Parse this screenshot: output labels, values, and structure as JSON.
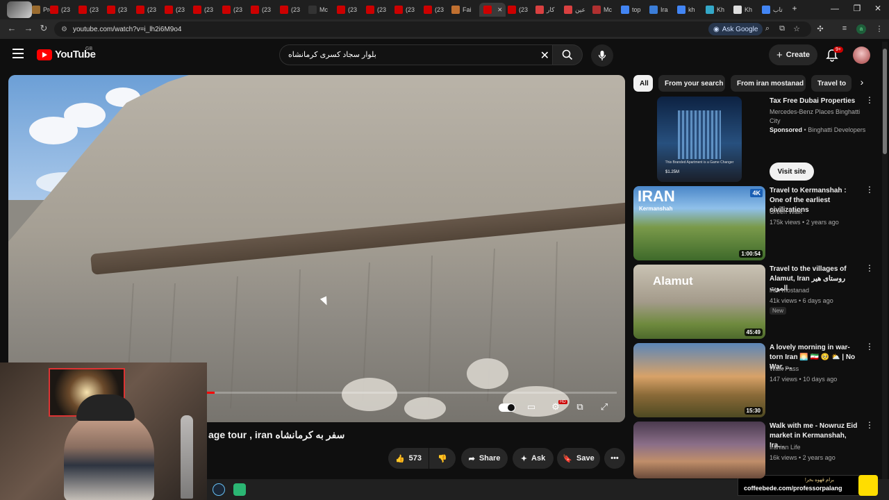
{
  "browser": {
    "tabs": [
      {
        "label": "Pro",
        "color": "#9a6b2e"
      },
      {
        "label": "(23",
        "color": "#cc0000"
      },
      {
        "label": "(23",
        "color": "#cc0000"
      },
      {
        "label": "(23",
        "color": "#cc0000"
      },
      {
        "label": "(23",
        "color": "#cc0000"
      },
      {
        "label": "(23",
        "color": "#cc0000"
      },
      {
        "label": "(23",
        "color": "#cc0000"
      },
      {
        "label": "(23",
        "color": "#cc0000"
      },
      {
        "label": "(23",
        "color": "#cc0000"
      },
      {
        "label": "(23",
        "color": "#cc0000"
      },
      {
        "label": "Mc",
        "color": "#333333"
      },
      {
        "label": "(23",
        "color": "#cc0000"
      },
      {
        "label": "(23",
        "color": "#cc0000"
      },
      {
        "label": "(23",
        "color": "#cc0000"
      },
      {
        "label": "(23",
        "color": "#cc0000"
      },
      {
        "label": "Fai",
        "color": "#c07030"
      },
      {
        "label": "",
        "color": "#cc0000"
      },
      {
        "label": "(23",
        "color": "#cc0000"
      },
      {
        "label": "کار",
        "color": "#d94040"
      },
      {
        "label": "عین",
        "color": "#d94040"
      },
      {
        "label": "Mc",
        "color": "#b03030"
      },
      {
        "label": "top",
        "color": "#4285f4"
      },
      {
        "label": "Ira",
        "color": "#3b7dd8"
      },
      {
        "label": "kh",
        "color": "#4285f4"
      },
      {
        "label": "Kh",
        "color": "#34a8c8"
      },
      {
        "label": "Kh",
        "color": "#dddddd"
      },
      {
        "label": "تاب",
        "color": "#4285f4"
      }
    ],
    "new_tab": "+",
    "window_controls": {
      "minimize": "—",
      "restore": "❐",
      "close": "✕"
    },
    "url": "youtube.com/watch?v=i_lh2i6M9o4",
    "ask_google": "Ask Google",
    "profile_initial": "a"
  },
  "youtube": {
    "logo": "YouTube",
    "region": "GB",
    "search_query": "بلوار سجاد کسری کرمانشاه",
    "create_label": "Create",
    "notification_count": "9+"
  },
  "video": {
    "title": "age tour , iran سفر به کرمانشاه",
    "progress": 0.33,
    "likes": "573",
    "share": "Share",
    "ask": "Ask",
    "save": "Save",
    "hd_badge": "HD"
  },
  "chips": [
    {
      "label": "All",
      "active": true
    },
    {
      "label": "From your search",
      "active": false
    },
    {
      "label": "From iran mostanad",
      "active": false
    },
    {
      "label": "Travel to",
      "active": false
    }
  ],
  "sidebar": {
    "ad": {
      "title": "Tax Free Dubai Properties",
      "advertiser": "Mercedes-Benz Places Binghatti City",
      "sponsored": "Sponsored",
      "sponsor_name": "Binghatti Developers",
      "visit": "Visit site",
      "thumb_caption": "This Branded Apartment is a Game Changer",
      "thumb_price": "$1.25M"
    },
    "items": [
      {
        "title": "Travel to Kermanshah : One of the earliest civilizations",
        "channel": "Green Walk",
        "meta": "175k views • 2 years ago",
        "duration": "1:00:54",
        "thumb_text": "IRAN",
        "thumb_sub": "Kermanshah",
        "thumb_badge": "4K"
      },
      {
        "title": "Travel to the villages of Alamut, Iran روستای هیر الموت",
        "channel": "iran mostanad",
        "meta": "41k views • 6 days ago",
        "duration": "45:49",
        "badge": "New",
        "thumb_text": "Alamut"
      },
      {
        "title": "A lovely morning in war-torn Iran 🌅 🇮🇷 🥺 ⛅ | No War, ...",
        "channel": "Walk Pass",
        "meta": "147 views • 10 days ago",
        "duration": "15:30"
      },
      {
        "title": "Walk with me - Nowruz Eid market in Kermanshah, Ira...",
        "channel": "Iranian Life",
        "meta": "16k views • 2 years ago",
        "duration": ""
      }
    ]
  },
  "overlay": {
    "coffee_label": "برام قهوه بخر!",
    "coffee_url": "coffeebede.com/professorpalang"
  }
}
